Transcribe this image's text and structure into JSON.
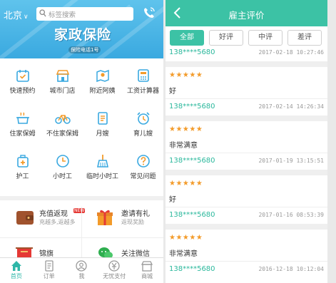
{
  "left": {
    "city": "北京",
    "search_placeholder": "标签搜索",
    "banner": {
      "title": "家政保险",
      "subtitle": "保险电话1号"
    },
    "grid": [
      {
        "label": "快速预约",
        "icon": "calendar-check-icon"
      },
      {
        "label": "城市门店",
        "icon": "store-icon"
      },
      {
        "label": "附近阿姨",
        "icon": "map-pin-icon"
      },
      {
        "label": "工资计算器",
        "icon": "calculator-icon"
      },
      {
        "label": "住家保姆",
        "icon": "cooking-pot-icon"
      },
      {
        "label": "不住家保姆",
        "icon": "bicycle-icon"
      },
      {
        "label": "月嫂",
        "icon": "document-icon"
      },
      {
        "label": "育儿嫂",
        "icon": "alarm-clock-icon"
      },
      {
        "label": "护工",
        "icon": "medicine-box-icon"
      },
      {
        "label": "小时工",
        "icon": "clock-icon"
      },
      {
        "label": "临时小时工",
        "icon": "broom-icon"
      },
      {
        "label": "常见问题",
        "icon": "question-icon"
      }
    ],
    "promos": [
      {
        "title": "充值返现",
        "subtitle": "充越多,返越多",
        "badge": "NEW",
        "icon": "wallet-icon"
      },
      {
        "title": "邀请有礼",
        "subtitle": "返现奖励",
        "icon": "gift-icon"
      }
    ],
    "promos2": [
      {
        "title": "锦旗",
        "icon": "banner-flag-icon"
      },
      {
        "title": "关注微信",
        "icon": "wechat-icon"
      }
    ],
    "tabs": [
      {
        "label": "首页",
        "icon": "home-icon",
        "active": true
      },
      {
        "label": "订单",
        "icon": "order-icon"
      },
      {
        "label": "我",
        "icon": "user-icon"
      },
      {
        "label": "无忧支付",
        "icon": "pay-icon"
      },
      {
        "label": "商城",
        "icon": "shop-icon"
      }
    ]
  },
  "right": {
    "title": "雇主评价",
    "filters": [
      {
        "label": "全部",
        "active": true
      },
      {
        "label": "好评"
      },
      {
        "label": "中评"
      },
      {
        "label": "差评"
      }
    ],
    "reviews": [
      {
        "partial": true,
        "phone": "138****5680",
        "date": "2017-02-18 10:27:46"
      },
      {
        "stars": "★★★★★",
        "text": "好",
        "phone": "138****5680",
        "date": "2017-02-14 14:26:34"
      },
      {
        "stars": "★★★★★",
        "text": "非常满意",
        "phone": "138****5680",
        "date": "2017-01-19 13:15:51"
      },
      {
        "stars": "★★★★★",
        "text": "好",
        "phone": "138****5680",
        "date": "2017-01-16 08:53:39"
      },
      {
        "stars": "★★★★★",
        "text": "非常满意",
        "phone": "138****5680",
        "date": "2016-12-18 10:12:04"
      }
    ]
  },
  "colors": {
    "accent_teal": "#3cc2a5",
    "banner_blue": "#3aa9e0",
    "star_orange": "#f39b2a"
  }
}
